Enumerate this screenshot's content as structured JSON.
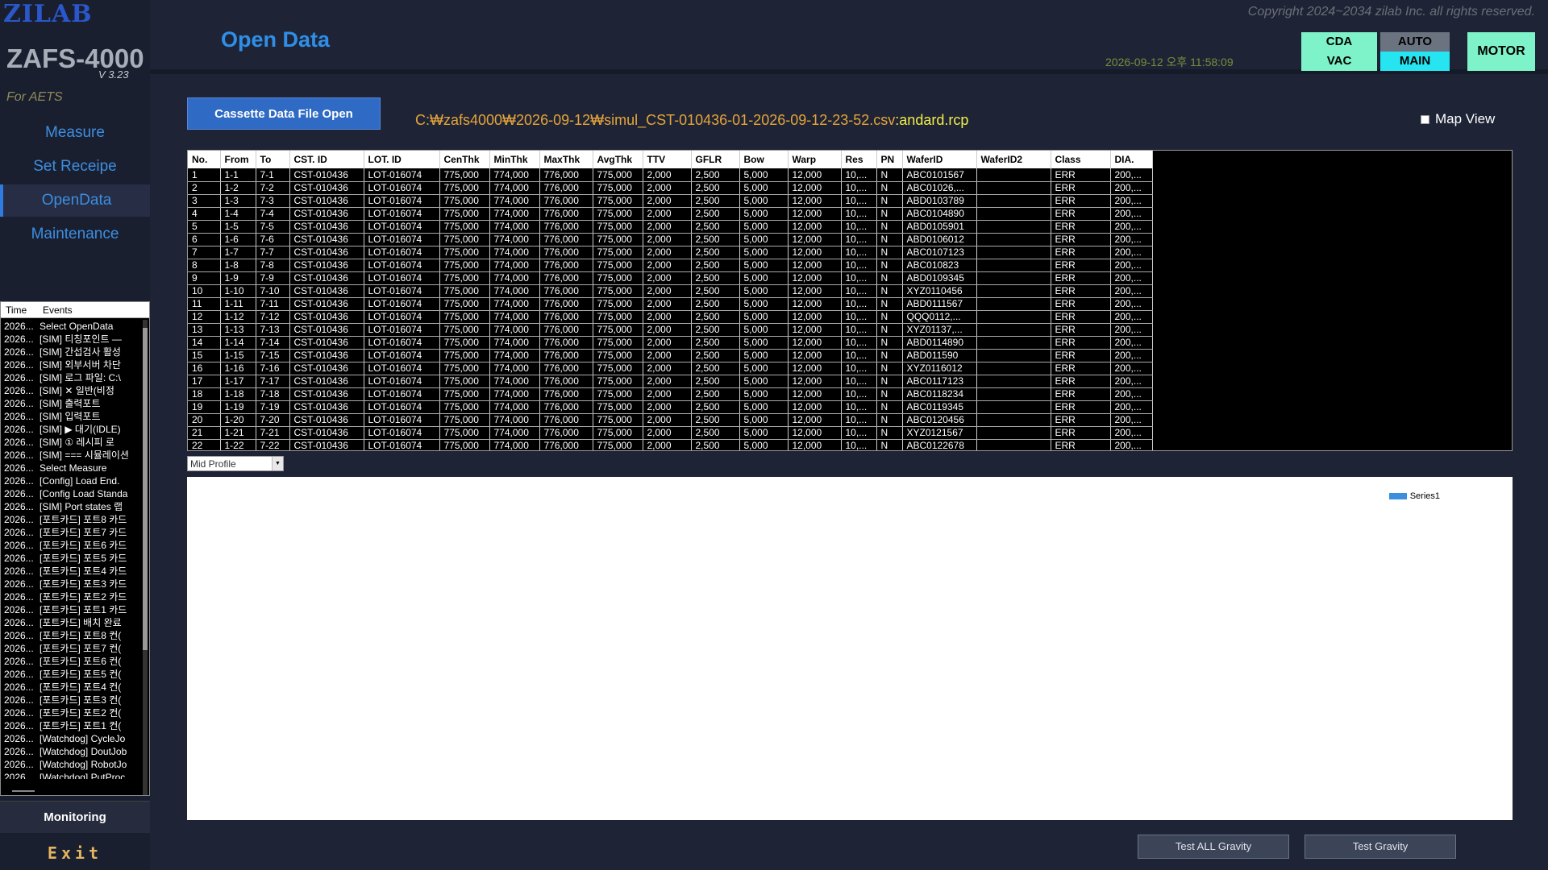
{
  "sidebar": {
    "logo": "ZILAB",
    "model": "ZAFS-4000",
    "version": "V 3.23",
    "for_label": "For AETS",
    "nav": [
      {
        "label": "Measure",
        "active": false
      },
      {
        "label": "Set Receipe",
        "active": false
      },
      {
        "label": "OpenData",
        "active": true
      },
      {
        "label": "Maintenance",
        "active": false
      }
    ],
    "monitoring_label": "Monitoring",
    "exit_label": "Exit"
  },
  "event_log": {
    "columns": [
      "Time",
      "Events"
    ],
    "rows": [
      {
        "time": "2026...",
        "msg": "Select OpenData"
      },
      {
        "time": "2026...",
        "msg": "[SIM] 티칭포인트 —"
      },
      {
        "time": "2026...",
        "msg": "[SIM] 간섭검사 활성"
      },
      {
        "time": "2026...",
        "msg": "[SIM] 외부서버 차단"
      },
      {
        "time": "2026...",
        "msg": "[SIM] 로그 파일: C:\\"
      },
      {
        "time": "2026...",
        "msg": "[SIM]     ✕ 일반(비정"
      },
      {
        "time": "2026...",
        "msg": "[SIM]       출력포트"
      },
      {
        "time": "2026...",
        "msg": "[SIM]       입력포트"
      },
      {
        "time": "2026...",
        "msg": "[SIM] ▶ 대기(IDLE)"
      },
      {
        "time": "2026...",
        "msg": "[SIM]    ① 레시피 로"
      },
      {
        "time": "2026...",
        "msg": "[SIM] === 시뮬레이션"
      },
      {
        "time": "2026...",
        "msg": "Select Measure"
      },
      {
        "time": "2026...",
        "msg": "[Config] Load End."
      },
      {
        "time": "2026...",
        "msg": "[Config Load Standa"
      },
      {
        "time": "2026...",
        "msg": "[SIM] Port states 랩"
      },
      {
        "time": "2026...",
        "msg": "[포트카드] 포트8 카드"
      },
      {
        "time": "2026...",
        "msg": "[포트카드] 포트7 카드"
      },
      {
        "time": "2026...",
        "msg": "[포트카드] 포트6 카드"
      },
      {
        "time": "2026...",
        "msg": "[포트카드] 포트5 카드"
      },
      {
        "time": "2026...",
        "msg": "[포트카드] 포트4 카드"
      },
      {
        "time": "2026...",
        "msg": "[포트카드] 포트3 카드"
      },
      {
        "time": "2026...",
        "msg": "[포트카드] 포트2 카드"
      },
      {
        "time": "2026...",
        "msg": "[포트카드] 포트1 카드"
      },
      {
        "time": "2026...",
        "msg": "[포트카드] 배치 완료"
      },
      {
        "time": "2026...",
        "msg": "[포트카드] 포트8 컨("
      },
      {
        "time": "2026...",
        "msg": "[포트카드] 포트7 컨("
      },
      {
        "time": "2026...",
        "msg": "[포트카드] 포트6 컨("
      },
      {
        "time": "2026...",
        "msg": "[포트카드] 포트5 컨("
      },
      {
        "time": "2026...",
        "msg": "[포트카드] 포트4 컨("
      },
      {
        "time": "2026...",
        "msg": "[포트카드] 포트3 컨("
      },
      {
        "time": "2026...",
        "msg": "[포트카드] 포트2 컨("
      },
      {
        "time": "2026...",
        "msg": "[포트카드] 포트1 컨("
      },
      {
        "time": "2026...",
        "msg": "[Watchdog] CycleJo"
      },
      {
        "time": "2026...",
        "msg": "[Watchdog] DoutJob"
      },
      {
        "time": "2026...",
        "msg": "[Watchdog] RobotJo"
      },
      {
        "time": "2026...",
        "msg": "[Watchdog] PutProc"
      }
    ]
  },
  "header": {
    "title": "Open Data",
    "copyright": "Copyright 2024~2034 zilab Inc. all rights reserved.",
    "datetime": "2026-09-12 오후 11:58:09",
    "cda": "CDA",
    "vac": "VAC",
    "auto": "AUTO",
    "main": "MAIN",
    "motor": "MOTOR"
  },
  "main": {
    "open_button": "Cassette Data  File Open",
    "file_path": "C:₩zafs4000₩2026-09-12₩simul_CST-010436-01-2026-09-12-23-52.csv",
    "rcp_name": ":andard.rcp",
    "map_view_label": "Map View",
    "profile_select": "Mid Profile",
    "legend_series": "Series1",
    "test_all_gravity": "Test ALL Gravity",
    "test_gravity": "Test Gravity"
  },
  "table": {
    "columns": [
      "No.",
      "From",
      "To",
      "CST. ID",
      "LOT. ID",
      "CenThk",
      "MinThk",
      "MaxThk",
      "AvgThk",
      "TTV",
      "GFLR",
      "Bow",
      "Warp",
      "Res",
      "PN",
      "WaferID",
      "WaferID2",
      "Class",
      "DIA."
    ],
    "rows": [
      [
        "1",
        "1-1",
        "7-1",
        "CST-010436",
        "LOT-016074",
        "775,000",
        "774,000",
        "776,000",
        "775,000",
        "2,000",
        "2,500",
        "5,000",
        "12,000",
        "10,...",
        "N",
        "ABC0101567",
        "",
        "ERR",
        "200,..."
      ],
      [
        "2",
        "1-2",
        "7-2",
        "CST-010436",
        "LOT-016074",
        "775,000",
        "774,000",
        "776,000",
        "775,000",
        "2,000",
        "2,500",
        "5,000",
        "12,000",
        "10,...",
        "N",
        "ABC01026,...",
        "",
        "ERR",
        "200,..."
      ],
      [
        "3",
        "1-3",
        "7-3",
        "CST-010436",
        "LOT-016074",
        "775,000",
        "774,000",
        "776,000",
        "775,000",
        "2,000",
        "2,500",
        "5,000",
        "12,000",
        "10,...",
        "N",
        "ABD0103789",
        "",
        "ERR",
        "200,..."
      ],
      [
        "4",
        "1-4",
        "7-4",
        "CST-010436",
        "LOT-016074",
        "775,000",
        "774,000",
        "776,000",
        "775,000",
        "2,000",
        "2,500",
        "5,000",
        "12,000",
        "10,...",
        "N",
        "ABC0104890",
        "",
        "ERR",
        "200,..."
      ],
      [
        "5",
        "1-5",
        "7-5",
        "CST-010436",
        "LOT-016074",
        "775,000",
        "774,000",
        "776,000",
        "775,000",
        "2,000",
        "2,500",
        "5,000",
        "12,000",
        "10,...",
        "N",
        "ABD0105901",
        "",
        "ERR",
        "200,..."
      ],
      [
        "6",
        "1-6",
        "7-6",
        "CST-010436",
        "LOT-016074",
        "775,000",
        "774,000",
        "776,000",
        "775,000",
        "2,000",
        "2,500",
        "5,000",
        "12,000",
        "10,...",
        "N",
        "ABD0106012",
        "",
        "ERR",
        "200,..."
      ],
      [
        "7",
        "1-7",
        "7-7",
        "CST-010436",
        "LOT-016074",
        "775,000",
        "774,000",
        "776,000",
        "775,000",
        "2,000",
        "2,500",
        "5,000",
        "12,000",
        "10,...",
        "N",
        "ABC0107123",
        "",
        "ERR",
        "200,..."
      ],
      [
        "8",
        "1-8",
        "7-8",
        "CST-010436",
        "LOT-016074",
        "775,000",
        "774,000",
        "776,000",
        "775,000",
        "2,000",
        "2,500",
        "5,000",
        "12,000",
        "10,...",
        "N",
        "ABC010823",
        "",
        "ERR",
        "200,..."
      ],
      [
        "9",
        "1-9",
        "7-9",
        "CST-010436",
        "LOT-016074",
        "775,000",
        "774,000",
        "776,000",
        "775,000",
        "2,000",
        "2,500",
        "5,000",
        "12,000",
        "10,...",
        "N",
        "ABD0109345",
        "",
        "ERR",
        "200,..."
      ],
      [
        "10",
        "1-10",
        "7-10",
        "CST-010436",
        "LOT-016074",
        "775,000",
        "774,000",
        "776,000",
        "775,000",
        "2,000",
        "2,500",
        "5,000",
        "12,000",
        "10,...",
        "N",
        "XYZ0110456",
        "",
        "ERR",
        "200,..."
      ],
      [
        "11",
        "1-11",
        "7-11",
        "CST-010436",
        "LOT-016074",
        "775,000",
        "774,000",
        "776,000",
        "775,000",
        "2,000",
        "2,500",
        "5,000",
        "12,000",
        "10,...",
        "N",
        "ABD0111567",
        "",
        "ERR",
        "200,..."
      ],
      [
        "12",
        "1-12",
        "7-12",
        "CST-010436",
        "LOT-016074",
        "775,000",
        "774,000",
        "776,000",
        "775,000",
        "2,000",
        "2,500",
        "5,000",
        "12,000",
        "10,...",
        "N",
        "QQQ0112,...",
        "",
        "ERR",
        "200,..."
      ],
      [
        "13",
        "1-13",
        "7-13",
        "CST-010436",
        "LOT-016074",
        "775,000",
        "774,000",
        "776,000",
        "775,000",
        "2,000",
        "2,500",
        "5,000",
        "12,000",
        "10,...",
        "N",
        "XYZ01137,...",
        "",
        "ERR",
        "200,..."
      ],
      [
        "14",
        "1-14",
        "7-14",
        "CST-010436",
        "LOT-016074",
        "775,000",
        "774,000",
        "776,000",
        "775,000",
        "2,000",
        "2,500",
        "5,000",
        "12,000",
        "10,...",
        "N",
        "ABD0114890",
        "",
        "ERR",
        "200,..."
      ],
      [
        "15",
        "1-15",
        "7-15",
        "CST-010436",
        "LOT-016074",
        "775,000",
        "774,000",
        "776,000",
        "775,000",
        "2,000",
        "2,500",
        "5,000",
        "12,000",
        "10,...",
        "N",
        "ABD011590",
        "",
        "ERR",
        "200,..."
      ],
      [
        "16",
        "1-16",
        "7-16",
        "CST-010436",
        "LOT-016074",
        "775,000",
        "774,000",
        "776,000",
        "775,000",
        "2,000",
        "2,500",
        "5,000",
        "12,000",
        "10,...",
        "N",
        "XYZ0116012",
        "",
        "ERR",
        "200,..."
      ],
      [
        "17",
        "1-17",
        "7-17",
        "CST-010436",
        "LOT-016074",
        "775,000",
        "774,000",
        "776,000",
        "775,000",
        "2,000",
        "2,500",
        "5,000",
        "12,000",
        "10,...",
        "N",
        "ABC0117123",
        "",
        "ERR",
        "200,..."
      ],
      [
        "18",
        "1-18",
        "7-18",
        "CST-010436",
        "LOT-016074",
        "775,000",
        "774,000",
        "776,000",
        "775,000",
        "2,000",
        "2,500",
        "5,000",
        "12,000",
        "10,...",
        "N",
        "ABC0118234",
        "",
        "ERR",
        "200,..."
      ],
      [
        "19",
        "1-19",
        "7-19",
        "CST-010436",
        "LOT-016074",
        "775,000",
        "774,000",
        "776,000",
        "775,000",
        "2,000",
        "2,500",
        "5,000",
        "12,000",
        "10,...",
        "N",
        "ABC0119345",
        "",
        "ERR",
        "200,..."
      ],
      [
        "20",
        "1-20",
        "7-20",
        "CST-010436",
        "LOT-016074",
        "775,000",
        "774,000",
        "776,000",
        "775,000",
        "2,000",
        "2,500",
        "5,000",
        "12,000",
        "10,...",
        "N",
        "ABC0120456",
        "",
        "ERR",
        "200,..."
      ],
      [
        "21",
        "1-21",
        "7-21",
        "CST-010436",
        "LOT-016074",
        "775,000",
        "774,000",
        "776,000",
        "775,000",
        "2,000",
        "2,500",
        "5,000",
        "12,000",
        "10,...",
        "N",
        "XYZ0121567",
        "",
        "ERR",
        "200,..."
      ],
      [
        "22",
        "1-22",
        "7-22",
        "CST-010436",
        "LOT-016074",
        "775,000",
        "774,000",
        "776,000",
        "775,000",
        "2,000",
        "2,500",
        "5,000",
        "12,000",
        "10,...",
        "N",
        "ABC0122678",
        "",
        "ERR",
        "200,..."
      ]
    ]
  },
  "colors": {
    "accent": "#2f8fe8",
    "status_green": "#7ef2c9",
    "status_cyan": "#26e4f0",
    "path_orange": "#e6a43a",
    "rcp_yellow": "#f4ee4a"
  }
}
